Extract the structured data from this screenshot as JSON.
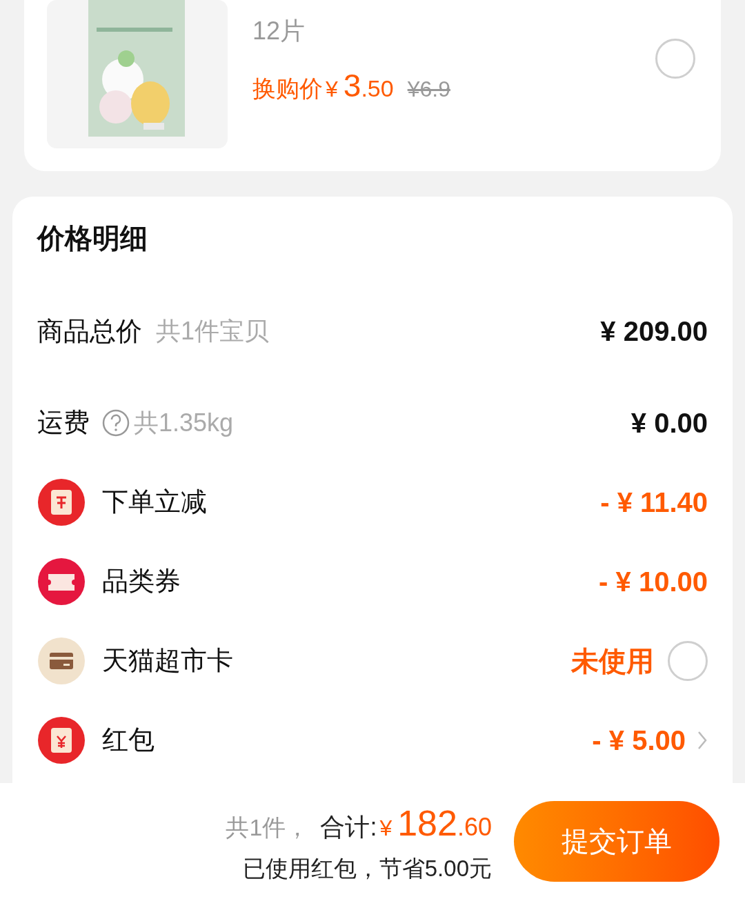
{
  "product": {
    "spec": "12片",
    "price_label": "换购价",
    "currency": "¥",
    "price_int": "3",
    "price_dec": ".50",
    "original_price": "¥6.9",
    "selected": false
  },
  "price_detail": {
    "title": "价格明细",
    "rows": [
      {
        "kind": "plain",
        "label": "商品总价",
        "note": "共1件宝贝",
        "value": "¥ 209.00"
      },
      {
        "kind": "help",
        "label": "运费",
        "note": "共1.35kg",
        "value": "¥ 0.00"
      },
      {
        "kind": "reduce",
        "label": "下单立减",
        "value": "- ¥ 11.40"
      },
      {
        "kind": "coupon",
        "label": "品类券",
        "value": "- ¥ 10.00"
      },
      {
        "kind": "card",
        "label": "天猫超市卡",
        "value": "未使用",
        "selected": false
      },
      {
        "kind": "envelope",
        "label": "红包",
        "value": "- ¥ 5.00"
      }
    ]
  },
  "footer": {
    "count": "共1件，",
    "total_label": "合计:",
    "currency": "¥",
    "total_int": "182",
    "total_dec": ".60",
    "saving": "已使用红包，节省5.00元",
    "submit": "提交订单"
  }
}
